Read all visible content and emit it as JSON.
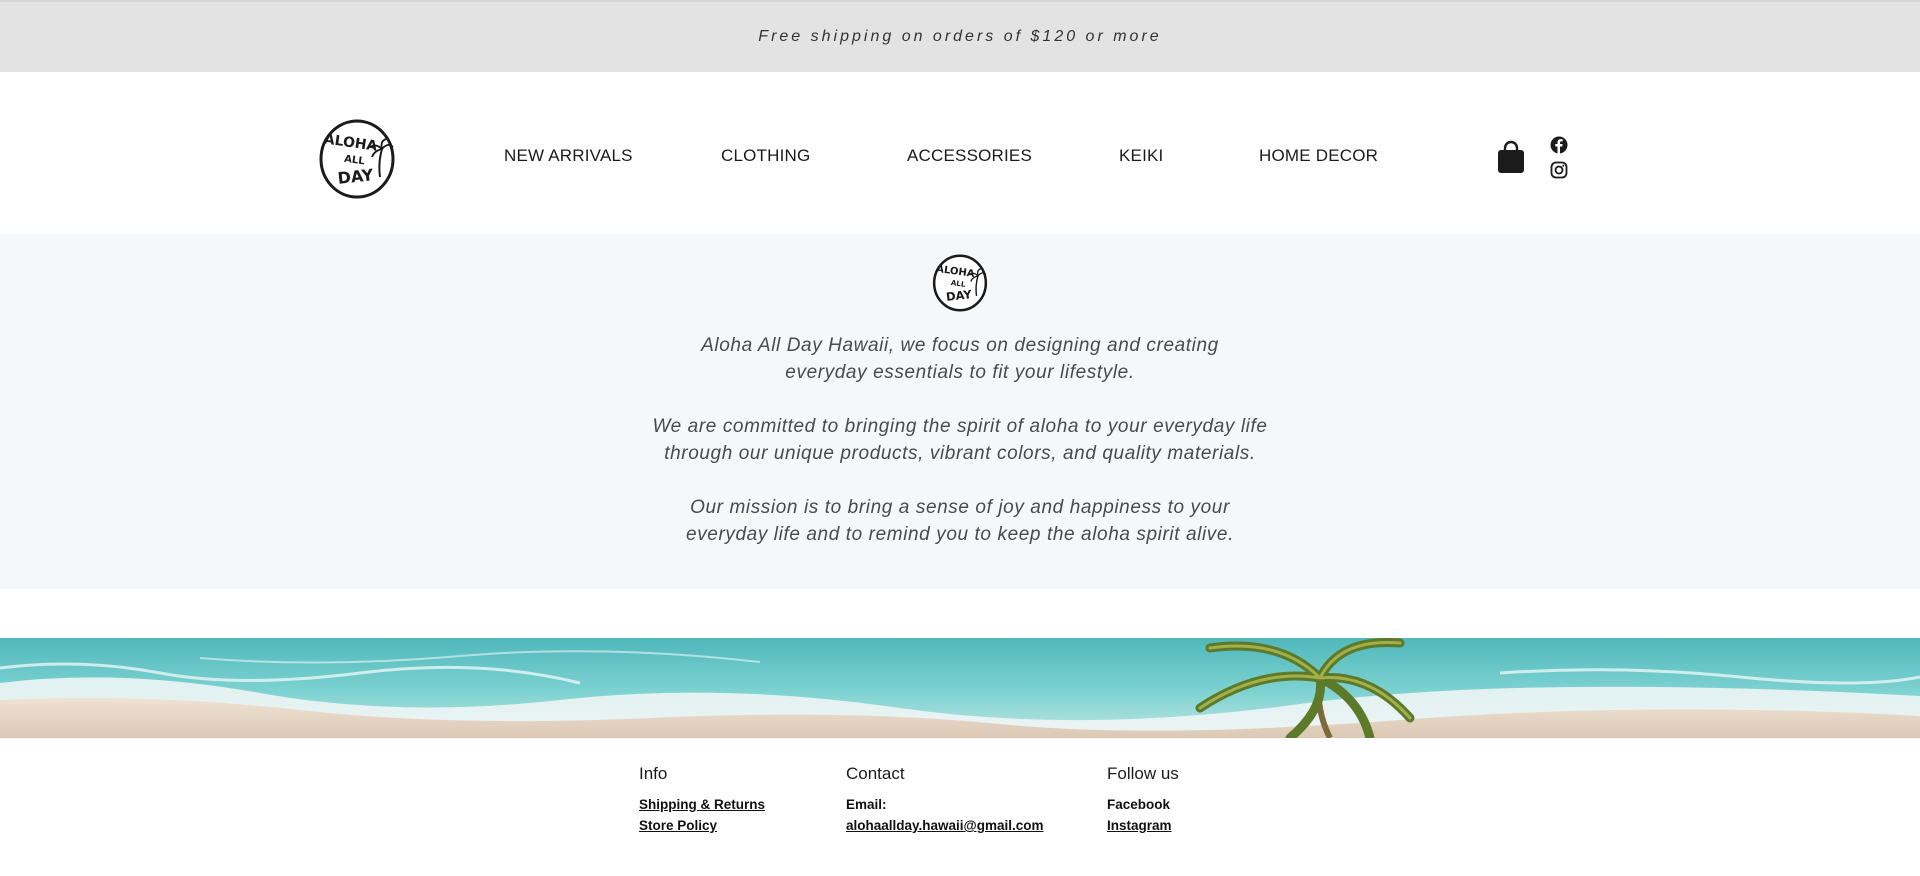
{
  "announcement": {
    "text": "Free shipping on orders of $120 or more"
  },
  "header": {
    "logo_text": [
      "ALOHA",
      "ALL",
      "DAY"
    ],
    "nav": [
      {
        "label": "NEW ARRIVALS"
      },
      {
        "label": "CLOTHING"
      },
      {
        "label": "ACCESSORIES"
      },
      {
        "label": "KEIKI"
      },
      {
        "label": "HOME DECOR"
      }
    ],
    "icons": {
      "cart": "shopping-bag-icon",
      "facebook": "facebook-icon",
      "instagram": "instagram-icon"
    }
  },
  "about": {
    "paragraphs": [
      [
        "Aloha All Day Hawaii, we focus on designing and creating",
        "everyday essentials to fit your lifestyle."
      ],
      [
        "We are committed to bringing the spirit of aloha to your everyday life",
        "through our unique products, vibrant colors, and quality materials."
      ],
      [
        "Our mission is to bring a sense of joy and happiness to your",
        "everyday life and to remind you to keep the aloha spirit alive."
      ]
    ]
  },
  "footer": {
    "info": {
      "title": "Info",
      "links": [
        "Shipping & Returns",
        "Store Policy"
      ]
    },
    "contact": {
      "title": "Contact",
      "email_label": "Email:",
      "email": "alohaallday.hawaii@gmail.com"
    },
    "follow": {
      "title": "Follow us",
      "facebook": "Facebook",
      "instagram": "Instagram"
    }
  },
  "colors": {
    "announce_bg": "#e3e3e3",
    "about_bg": "#f6f7f9",
    "text": "#1b1b1b",
    "ocean": "#5ec4c6",
    "sand": "#e7d8c8"
  }
}
